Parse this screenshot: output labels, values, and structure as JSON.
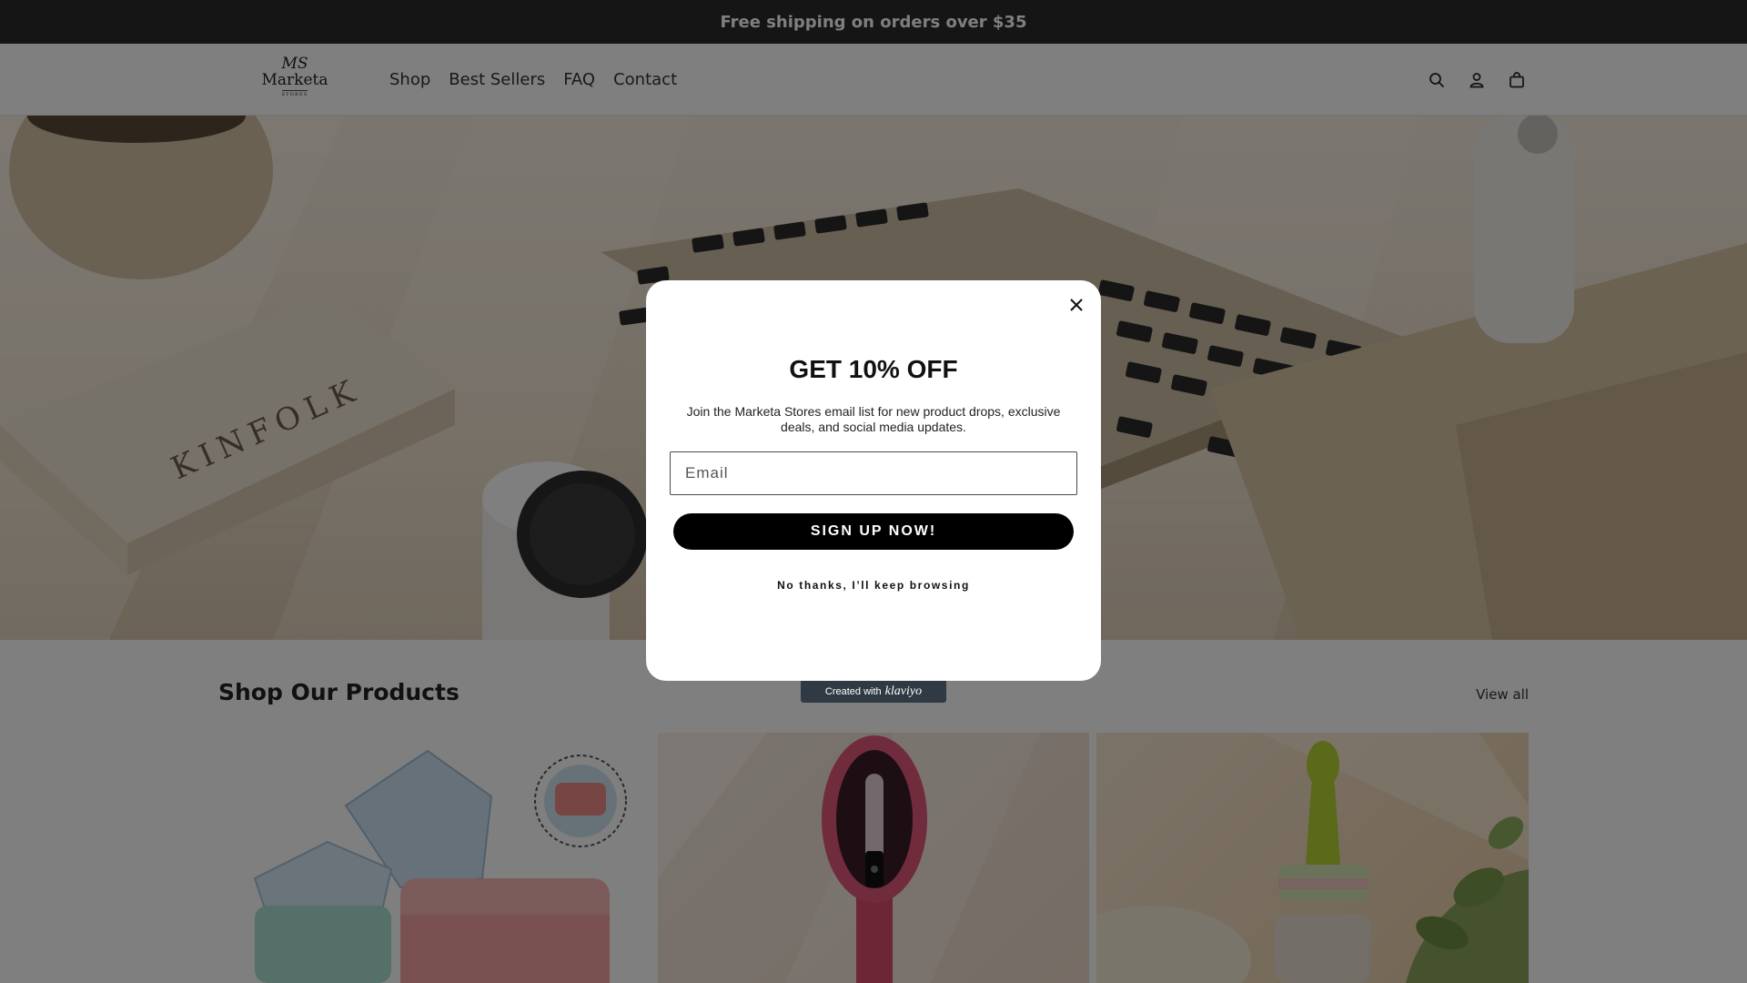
{
  "announcement": {
    "text": "Free shipping on orders over $35"
  },
  "header": {
    "logo": {
      "monogram": "MS",
      "name": "Marketa",
      "subtitle": "STORES"
    },
    "nav": [
      "Shop",
      "Best Sellers",
      "FAQ",
      "Contact"
    ],
    "icons": [
      "search-icon",
      "account-icon",
      "cart-icon"
    ]
  },
  "hero": {
    "book_text": "KINFOLK"
  },
  "products_section": {
    "title": "Shop Our Products",
    "view_all": "View all"
  },
  "popup": {
    "title": "GET 10% OFF",
    "text": "Join the Marketa Stores email list for new product drops, exclusive deals, and social media updates.",
    "email_placeholder": "Email",
    "signup_label": "SIGN UP NOW!",
    "no_thanks_label": "No thanks, I’ll keep browsing",
    "close_icon": "close-icon"
  },
  "badge": {
    "prefix": "Created with",
    "brand": "klaviyo"
  },
  "colors": {
    "announcement_bg": "#2b2b2b",
    "button_bg": "#000000",
    "overlay": "rgba(0,0,0,0.5)",
    "badge_bg": "#2f3a44"
  }
}
